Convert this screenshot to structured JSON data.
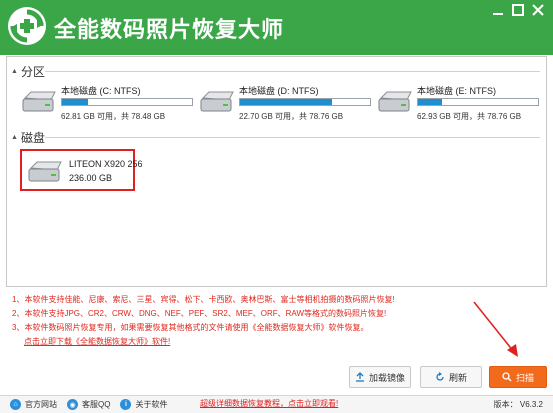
{
  "app": {
    "title": "全能数码照片恢复大师"
  },
  "partitions": {
    "heading": "分区",
    "items": [
      {
        "name": "本地磁盘 (C: NTFS)",
        "info": "62.81 GB 可用，共 78.48 GB",
        "used_fraction": 0.2
      },
      {
        "name": "本地磁盘 (D: NTFS)",
        "info": "22.70 GB 可用，共 78.76 GB",
        "used_fraction": 0.71
      },
      {
        "name": "本地磁盘 (E: NTFS)",
        "info": "62.93 GB 可用，共 78.76 GB",
        "used_fraction": 0.2
      }
    ]
  },
  "disks": {
    "heading": "磁盘",
    "items": [
      {
        "name": "LITEON X920 256",
        "size": "236.00 GB"
      }
    ]
  },
  "notes": [
    "1、本软件支持佳能、尼康、索尼、三星、宾得、松下、卡西欧、奥林巴斯、富士等相机拍摄的数码照片恢复!",
    "2、本软件支持JPG、CR2、CRW、DNG、NEF、PEF、SR2、MEF、ORF、RAW等格式的数码照片恢复!",
    "3、本软件数码照片恢复专用，如果需要恢复其他格式的文件请使用《全能数据恢复大师》软件恢复。",
    "点击立即下载《全能数据恢复大师》软件!"
  ],
  "buttons": {
    "load_image": "加载镜像",
    "refresh": "刷新",
    "scan": "扫描"
  },
  "statusbar": {
    "website": "官方网站",
    "qq": "客服QQ",
    "about": "关于软件",
    "promo": "超级详细数据恢复教程，点击立即观看!",
    "version": "版本： V6.3.2"
  },
  "colors": {
    "titlebar": "#3aa648",
    "bar_fill": "#1f8fd0",
    "note_red": "#e0281e",
    "scan_button": "#f26b1d"
  }
}
